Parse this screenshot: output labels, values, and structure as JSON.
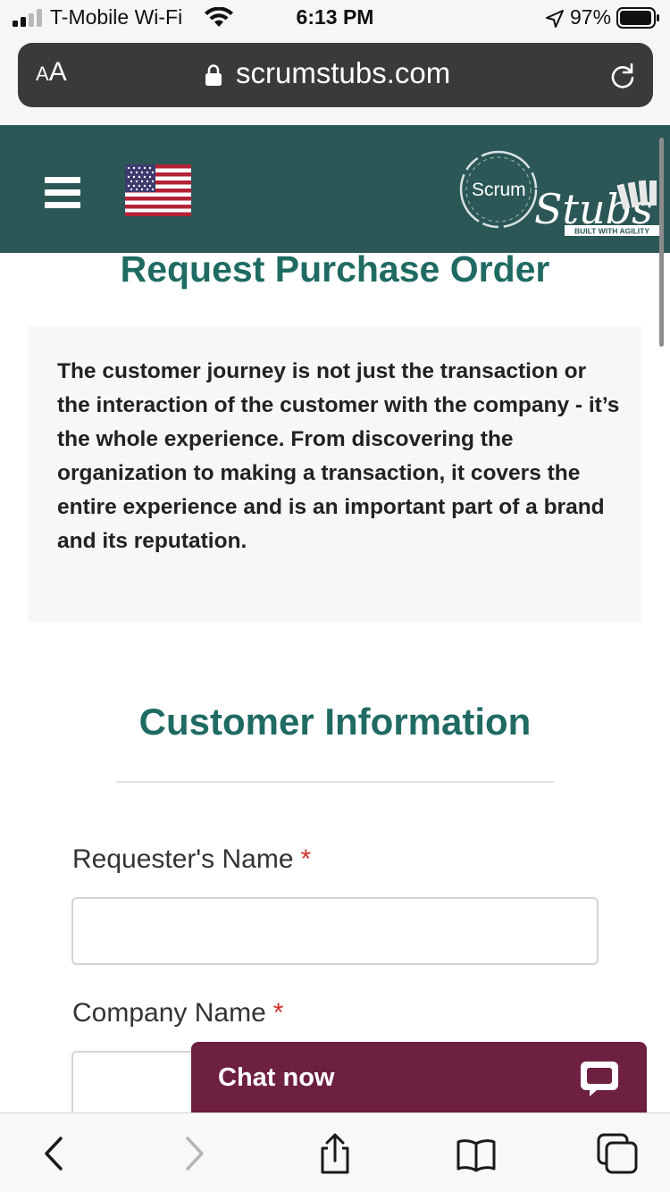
{
  "status_bar": {
    "carrier": "T-Mobile Wi-Fi",
    "time": "6:13 PM",
    "battery": "97%"
  },
  "browser": {
    "text_size_label_small": "A",
    "text_size_label_large": "A",
    "url": "scrumstubs.com"
  },
  "header": {
    "logo_word": "Scrum",
    "logo_script": "Stubs",
    "logo_tagline": "BUILT WITH AGILITY"
  },
  "page": {
    "title": "Request Purchase Order",
    "intro": "The customer journey is not just the transaction or the interaction of the customer with the company - it’s the whole experience. From discovering the organization to making a transaction, it covers the entire experience and is an important part of a brand and its reputation.",
    "section_title": "Customer Information"
  },
  "form": {
    "fields": [
      {
        "label": "Requester's Name",
        "required_mark": "*",
        "value": ""
      },
      {
        "label": "Company Name",
        "required_mark": "*",
        "value": ""
      }
    ]
  },
  "chat": {
    "label": "Chat now"
  },
  "colors": {
    "header_bg": "#2b5756",
    "heading": "#1f6b63",
    "chat_bg": "#6e2040",
    "required": "#d0312d"
  }
}
